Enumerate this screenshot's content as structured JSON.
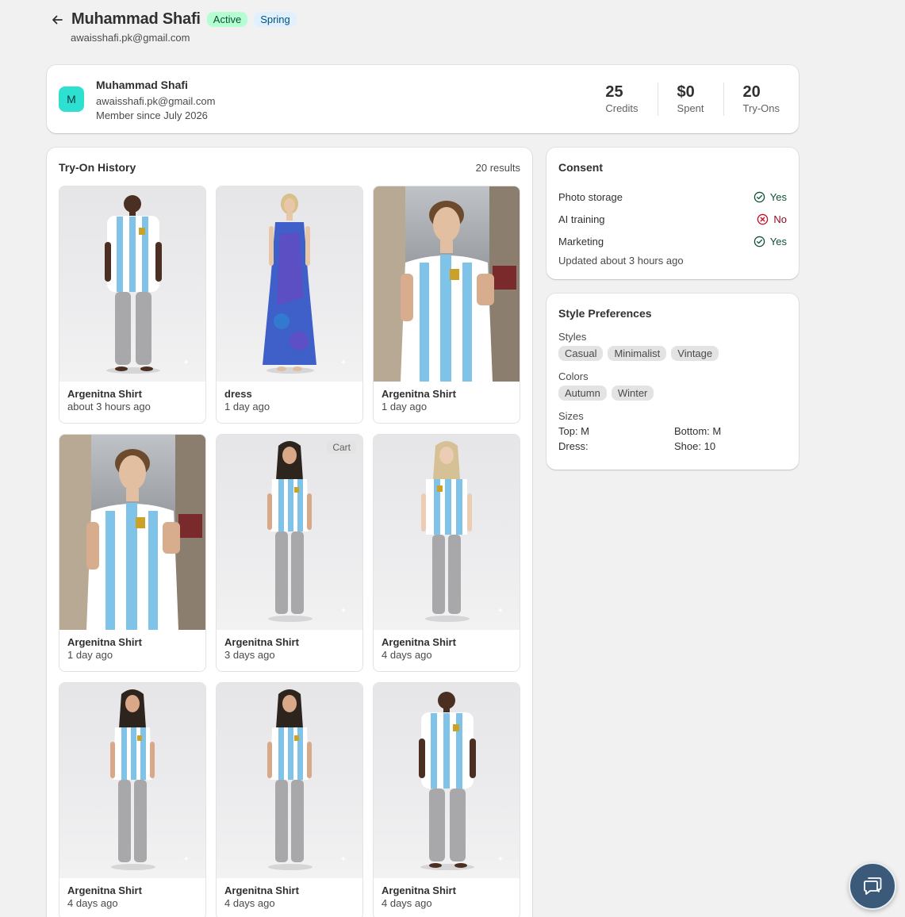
{
  "header": {
    "title": "Muhammad Shafi",
    "status_badge": "Active",
    "season_badge": "Spring",
    "email": "awaisshafi.pk@gmail.com"
  },
  "profile": {
    "avatar_initial": "M",
    "name": "Muhammad Shafi",
    "email": "awaisshafi.pk@gmail.com",
    "member_since": "Member since July 2026",
    "stats": [
      {
        "value": "25",
        "label": "Credits"
      },
      {
        "value": "$0",
        "label": "Spent"
      },
      {
        "value": "20",
        "label": "Try-Ons"
      }
    ]
  },
  "history": {
    "title": "Try-On History",
    "results": "20 results",
    "items": [
      {
        "title": "Argenitna Shirt",
        "time": "about 3 hours ago"
      },
      {
        "title": "dress",
        "time": "1 day ago"
      },
      {
        "title": "Argenitna Shirt",
        "time": "1 day ago"
      },
      {
        "title": "Argenitna Shirt",
        "time": "1 day ago"
      },
      {
        "title": "Argenitna Shirt",
        "time": "3 days ago",
        "badge": "Cart"
      },
      {
        "title": "Argenitna Shirt",
        "time": "4 days ago"
      },
      {
        "title": "Argenitna Shirt",
        "time": "4 days ago"
      },
      {
        "title": "Argenitna Shirt",
        "time": "4 days ago"
      },
      {
        "title": "Argenitna Shirt",
        "time": "4 days ago"
      }
    ]
  },
  "consent": {
    "title": "Consent",
    "rows": [
      {
        "label": "Photo storage",
        "value": "Yes"
      },
      {
        "label": "AI training",
        "value": "No"
      },
      {
        "label": "Marketing",
        "value": "Yes"
      }
    ],
    "updated": "Updated about 3 hours ago"
  },
  "preferences": {
    "title": "Style Preferences",
    "styles_label": "Styles",
    "styles": [
      "Casual",
      "Minimalist",
      "Vintage"
    ],
    "colors_label": "Colors",
    "colors": [
      "Autumn",
      "Winter"
    ],
    "sizes_label": "Sizes",
    "sizes": [
      "Top: M",
      "Bottom: M",
      "Dress:",
      "Shoe: 10"
    ]
  },
  "colors": {
    "active_bg": "#b4fed2",
    "season_bg": "#e0f0ff",
    "avatar_bg": "#2ee0d0",
    "yes_green": "#0c5132",
    "no_red": "#8e0b21",
    "chat_fab": "#3b5a79"
  }
}
